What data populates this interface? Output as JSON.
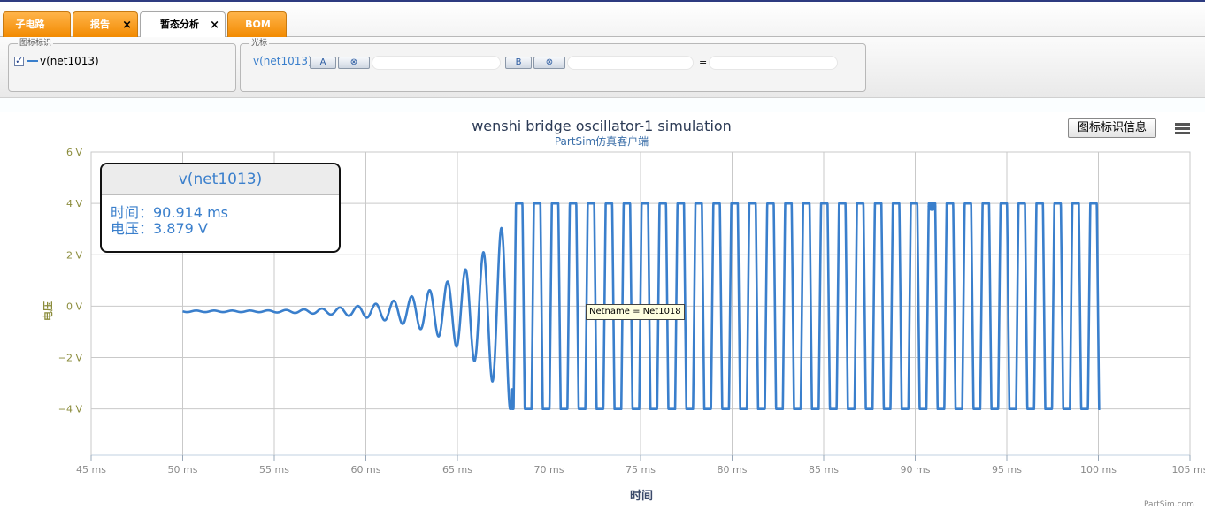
{
  "tabs": [
    {
      "label": "子电路",
      "closable": false,
      "active": false
    },
    {
      "label": "报告",
      "closable": true,
      "active": false
    },
    {
      "label": "暂态分析",
      "closable": true,
      "active": true
    },
    {
      "label": "BOM",
      "closable": false,
      "active": false
    }
  ],
  "close_glyph": "×",
  "legend_panel": {
    "title": "图标标识",
    "item_label": "v(net1013)",
    "checked": true
  },
  "cursor_panel": {
    "title": "光标",
    "signal": "v(net1013)",
    "cursor_a_label": "A",
    "cursor_b_label": "B",
    "clear_glyph": "⊗",
    "equals": "="
  },
  "toolbar_buttons": {
    "legend_info": "图标标识信息",
    "menu_icon": "hamburger-menu-icon"
  },
  "tooltip": {
    "series": "v(net1013)",
    "time_line": "时间：90.914 ms",
    "voltage_line": "电压：3.879 V"
  },
  "net_tooltip": "Netname = Net1018",
  "credit": "PartSim.com",
  "colors": {
    "series": "#3a7fcc",
    "tab_orange": "#f28a00",
    "axis_label": "#8b8c3c"
  },
  "chart_data": {
    "type": "line",
    "title": "wenshi bridge oscillator-1 simulation",
    "subtitle": "PartSim仿真客户端",
    "xlabel": "时间",
    "ylabel": "电压",
    "x_ticks": [
      "45 ms",
      "50 ms",
      "55 ms",
      "60 ms",
      "65 ms",
      "70 ms",
      "75 ms",
      "80 ms",
      "85 ms",
      "90 ms",
      "95 ms",
      "100 ms",
      "105 ms"
    ],
    "y_ticks": [
      "6 V",
      "4 V",
      "2 V",
      "0 V",
      "−2 V",
      "−4 V"
    ],
    "xlim": [
      45,
      105
    ],
    "ylim": [
      -5.8,
      6
    ],
    "grid": true,
    "series": [
      {
        "name": "v(net1013)",
        "x_start_ms": 50,
        "x_end_ms": 100.1,
        "offset_v": -0.2,
        "period_ms": 0.98,
        "peak_v": 4.0,
        "trough_v": -4.0,
        "growth_start_ms": 54,
        "saturation_ms": 68,
        "highlight_point": {
          "x_ms": 90.914,
          "y_v": 3.879
        }
      }
    ]
  }
}
